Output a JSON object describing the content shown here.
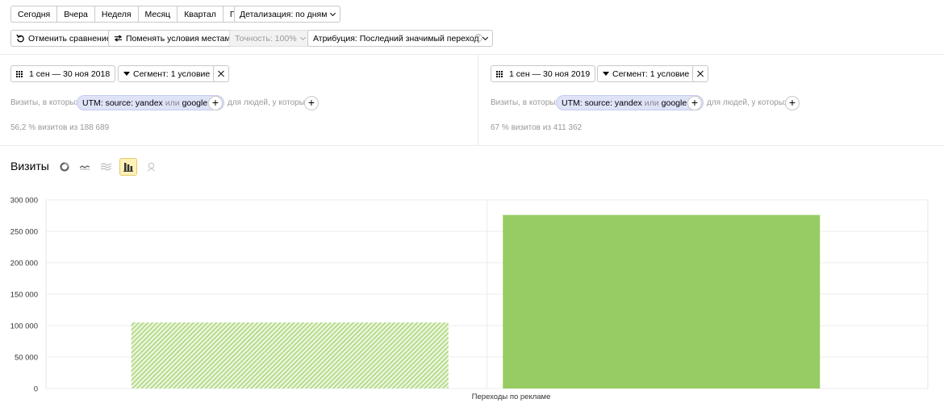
{
  "period_tabs": [
    "Сегодня",
    "Вчера",
    "Неделя",
    "Месяц",
    "Квартал",
    "Год"
  ],
  "detail_label": "Детализация: по дням",
  "toolbar": {
    "cancel_compare": "Отменить сравнение",
    "swap": "Поменять условия местами",
    "accuracy": "Точность: 100%",
    "attribution": "Атрибуция: Последний значимый переход"
  },
  "left": {
    "date_range": "1 сен — 30 ноя 2018",
    "segment": "Сегмент: 1 условие",
    "visits_label": "Визиты, в которых",
    "pill_prefix": "UTM: source: yandex",
    "pill_or": "или",
    "pill_suffix": "google",
    "people_label": "для людей, у которых",
    "stats": "56,2 % визитов из 188 689"
  },
  "right": {
    "date_range": "1 сен — 30 ноя 2019",
    "segment": "Сегмент: 1 условие",
    "visits_label": "Визиты, в которых",
    "pill_prefix": "UTM: source: yandex",
    "pill_or": "или",
    "pill_suffix": "google",
    "people_label": "для людей, у которых",
    "stats": "67 % визитов из 411 362"
  },
  "chart_title": "Визиты",
  "chart_data": {
    "type": "bar",
    "categories": [
      "Переходы по рекламе"
    ],
    "series": [
      {
        "values": [
          105000
        ],
        "pattern": "hatched",
        "color": "#9ccc65"
      },
      {
        "values": [
          276000
        ],
        "pattern": "solid",
        "color": "#97cc64"
      }
    ],
    "xlabel": "Переходы по рекламе",
    "ylim": [
      0,
      300000
    ],
    "yticks": [
      "0",
      "50 000",
      "100 000",
      "150 000",
      "200 000",
      "250 000",
      "300 000"
    ],
    "grid": true
  }
}
